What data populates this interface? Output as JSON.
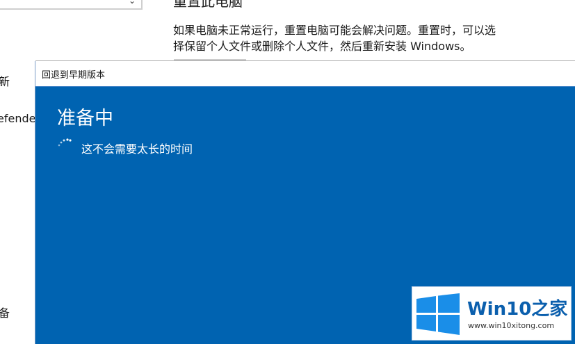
{
  "background": {
    "section_heading": "重置此电脑",
    "description_line1": "如果电脑未正常运行，重置电脑可能会解决问题。重置时，可以选",
    "description_line2": "择保留个人文件或删除个人文件，然后重新安装 Windows。",
    "nav_items": [
      "新",
      "efender",
      "备"
    ]
  },
  "dialog": {
    "title": "回退到早期版本",
    "heading": "准备中",
    "status": "这不会需要太长的时间",
    "background_color": "#0063b1"
  },
  "watermark": {
    "name": "Win10之家",
    "url": "www.win10xitong.com",
    "brand_color": "#0b5fad"
  },
  "icons": {
    "spinner": "loading-spinner-icon",
    "logo": "windows-logo-icon"
  }
}
